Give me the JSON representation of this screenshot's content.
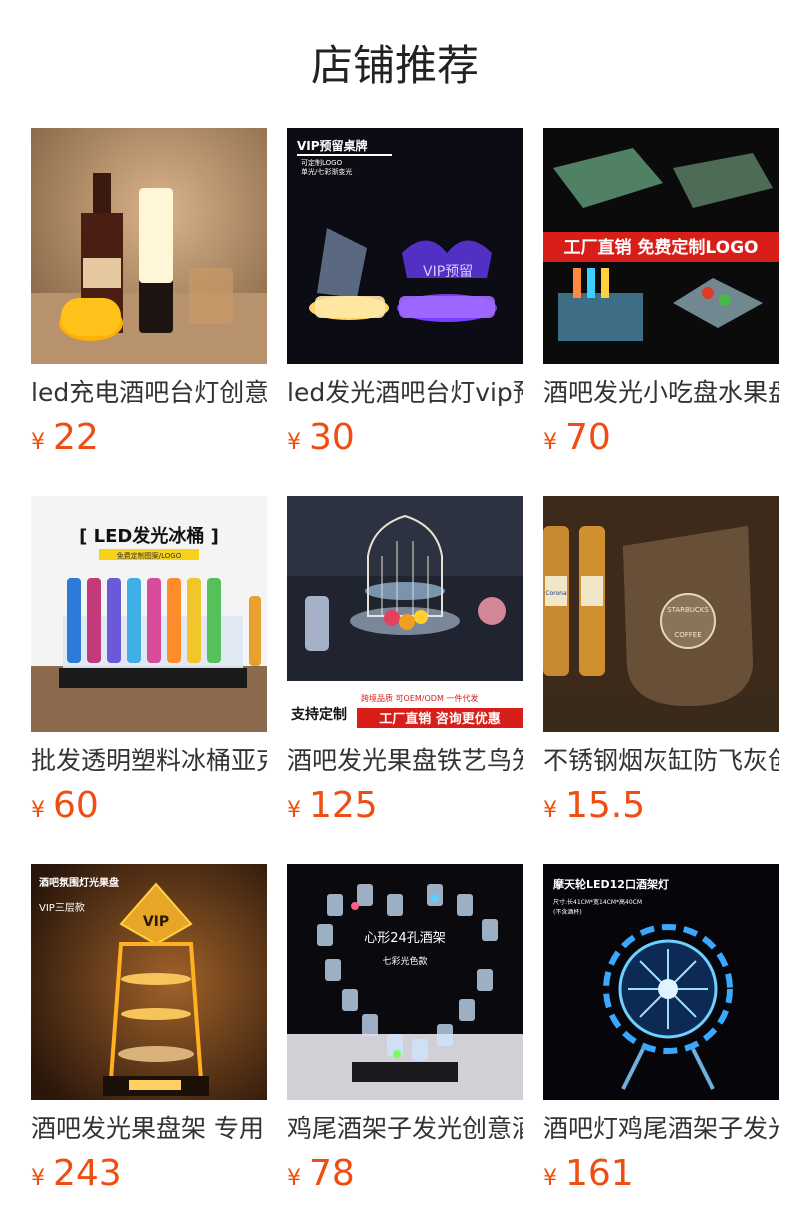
{
  "page": {
    "title": "店铺推荐"
  },
  "currency_symbol": "¥",
  "products": [
    {
      "name": "led充电酒吧台灯创意",
      "price": "22",
      "overlay": []
    },
    {
      "name": "led发光酒吧台灯vip预",
      "price": "30",
      "overlay": [
        "VIP预留桌牌",
        "可定制LOGO",
        "单光/七彩渐变光",
        "VIP预留"
      ]
    },
    {
      "name": "酒吧发光小吃盘水果盘",
      "price": "70",
      "overlay": [
        "工厂直销 免费定制LOGO"
      ]
    },
    {
      "name": "批发透明塑料冰桶亚克",
      "price": "60",
      "overlay": [
        "[ LED发光冰桶 ]",
        "免费定制图案/LOGO"
      ]
    },
    {
      "name": "酒吧发光果盘铁艺鸟笼",
      "price": "125",
      "overlay": [
        "支持定制",
        "跨境品质   可OEM/ODM   一件代发",
        "工厂直销 咨询更优惠"
      ]
    },
    {
      "name": "不锈钢烟灰缸防飞灰创",
      "price": "15.5",
      "overlay": [
        "STARBUCKS",
        "COFFEE",
        "Corona"
      ]
    },
    {
      "name": "酒吧发光果盘架 专用",
      "price": "243",
      "overlay": [
        "酒吧氛围灯光果盘",
        "VIP三层款",
        "VIP"
      ]
    },
    {
      "name": "鸡尾酒架子发光创意酒",
      "price": "78",
      "overlay": [
        "心形24孔酒架",
        "七彩光色款"
      ]
    },
    {
      "name": "酒吧灯鸡尾酒架子发光",
      "price": "161",
      "overlay": [
        "摩天轮LED12口酒架灯",
        "尺寸:长41CM*宽14CM*高40CM",
        "(不含酒杯)"
      ]
    }
  ]
}
